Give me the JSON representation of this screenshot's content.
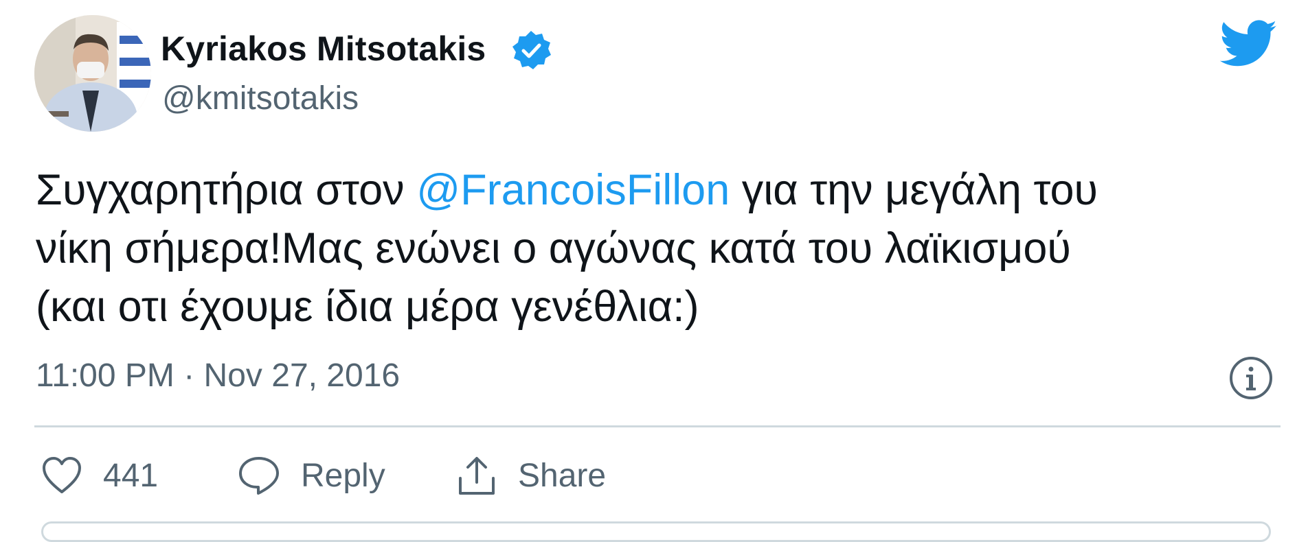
{
  "tweet": {
    "author": {
      "display_name": "Kyriakos Mitsotakis",
      "handle": "@kmitsotakis",
      "verified": true,
      "avatar_icon": "profile-photo"
    },
    "text": {
      "line1_before": "Συγχαρητήρια στον ",
      "mention": "@FrancoisFillon",
      "line1_after": " για την μεγάλη του",
      "line2": "νίκη σήμερα!Μας ενώνει ο αγώνας κατά του λαϊκισμού",
      "line3": "(και οτι έχουμε ίδια μέρα γενέθλια:)"
    },
    "timestamp": "11:00 PM · Nov 27, 2016",
    "actions": {
      "like_count": "441",
      "reply_label": "Reply",
      "share_label": "Share"
    },
    "icons": {
      "brand": "twitter-bird-icon",
      "verified": "verified-badge-icon",
      "info": "info-icon",
      "like": "heart-icon",
      "reply": "speech-bubble-icon",
      "share": "share-upload-icon"
    }
  },
  "colors": {
    "accent": "#1d9bf0",
    "text_primary": "#0f1419",
    "text_secondary": "#536471",
    "divider": "#cfd9de"
  }
}
